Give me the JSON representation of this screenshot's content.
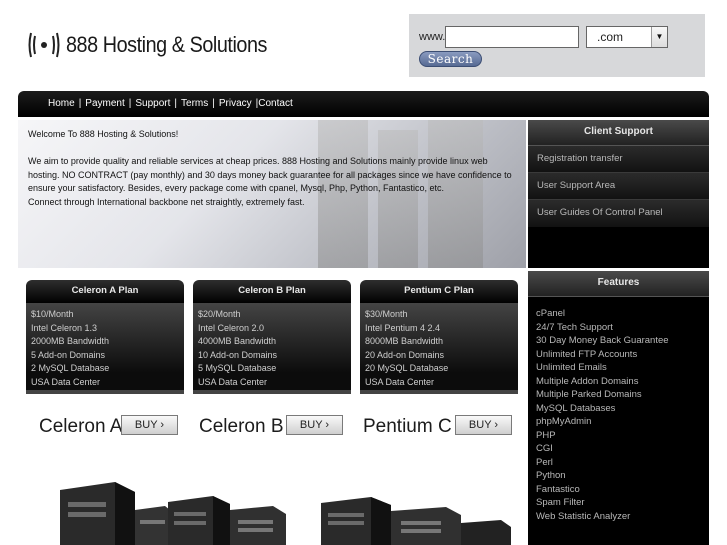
{
  "header": {
    "logo_text": "888 Hosting & Solutions"
  },
  "search": {
    "www_label": "www.",
    "domain_value": "",
    "tld_selected": ".com",
    "button_label": "Search"
  },
  "nav": {
    "items": [
      "Home",
      "Payment",
      "Support",
      "Terms",
      "Privacy",
      "Contact"
    ]
  },
  "welcome": {
    "title": "Welcome To 888 Hosting & Solutions!",
    "body_1": "We aim to provide quality and reliable services at cheap prices. 888 Hosting and Solutions mainly provide linux web hosting. NO CONTRACT (pay monthly) and 30 days money back guarantee for all packages since we have confidence to ensure your satisfactory. Besides, every package come with cpanel, Mysql, Php, Python, Fantastico, etc.",
    "body_2": "Connect through International backbone net straightly, extremely fast."
  },
  "client_support": {
    "title": "Client Support",
    "items": [
      "Registration transfer",
      "User Support Area",
      "User Guides Of Control Panel"
    ]
  },
  "features": {
    "title": "Features",
    "items": [
      "cPanel",
      "24/7 Tech Support",
      "30 Day Money Back Guarantee",
      "Unlimited FTP Accounts",
      "Unlimited Emails",
      "Multiple Addon Domains",
      "Multiple Parked Domains",
      "MySQL Databases",
      "phpMyAdmin",
      "PHP",
      "CGI",
      "Perl",
      "Python",
      "Fantastico",
      "Spam Filter",
      "Web Statistic Analyzer"
    ]
  },
  "plans": [
    {
      "name": "Celeron A Plan",
      "lines": [
        "$10/Month",
        "Intel Celeron 1.3",
        "2000MB Bandwidth",
        "5 Add-on Domains",
        "2 MySQL Database",
        "USA Data Center"
      ],
      "buy_label": "Celeron A"
    },
    {
      "name": "Celeron B Plan",
      "lines": [
        "$20/Month",
        "Intel Celeron 2.0",
        "4000MB Bandwidth",
        "10 Add-on Domains",
        "5 MySQL Database",
        "USA Data Center"
      ],
      "buy_label": "Celeron B"
    },
    {
      "name": "Pentium C Plan",
      "lines": [
        "$30/Month",
        "Intel Pentium 4 2.4",
        "8000MB Bandwidth",
        "20 Add-on Domains",
        "20 MySQL Database",
        "USA Data Center"
      ],
      "buy_label": "Pentium C"
    }
  ],
  "buy_button_label": "BUY",
  "colors": {
    "search_button": "#566a93",
    "nav_background": "#000000",
    "sidebar_background": "#000000"
  }
}
